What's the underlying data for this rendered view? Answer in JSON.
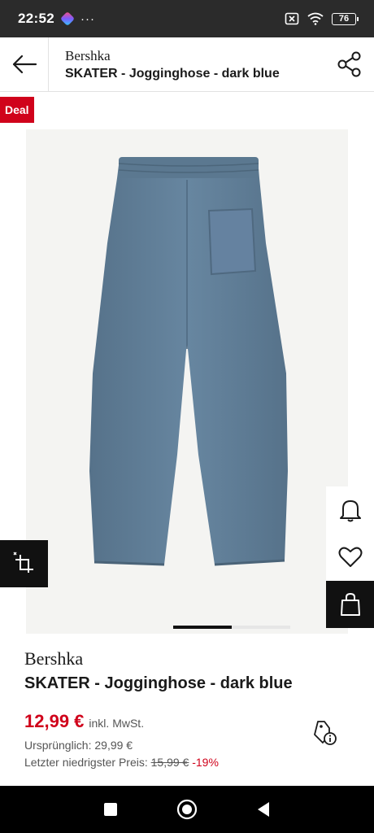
{
  "status_bar": {
    "time": "22:52",
    "more": "···",
    "battery": "76"
  },
  "header": {
    "brand": "Bershka",
    "title": "SKATER - Jogginghose - dark blue"
  },
  "gallery": {
    "badge": "Deal",
    "pages": 2,
    "active_page": 1
  },
  "product": {
    "brand": "Bershka",
    "title": "SKATER - Jogginghose - dark blue",
    "price": "12,99 €",
    "vat": "inkl. MwSt.",
    "original": "Ursprünglich: 29,99 €",
    "lowest_label": "Letzter niedrigster Preis:",
    "lowest_price": "15,99 €",
    "discount": "-19%"
  },
  "colors": {
    "accent": "#d0021b",
    "pants": "#5f7d95"
  },
  "icons": {
    "header": [
      "back-arrow-icon",
      "share-icon"
    ],
    "side": [
      "bell-icon",
      "heart-icon",
      "bag-icon"
    ],
    "gallery": [
      "similar-items-icon"
    ],
    "info": [
      "price-tag-info-icon"
    ],
    "nav": [
      "square-icon",
      "home-circle-icon",
      "back-triangle-icon"
    ]
  }
}
